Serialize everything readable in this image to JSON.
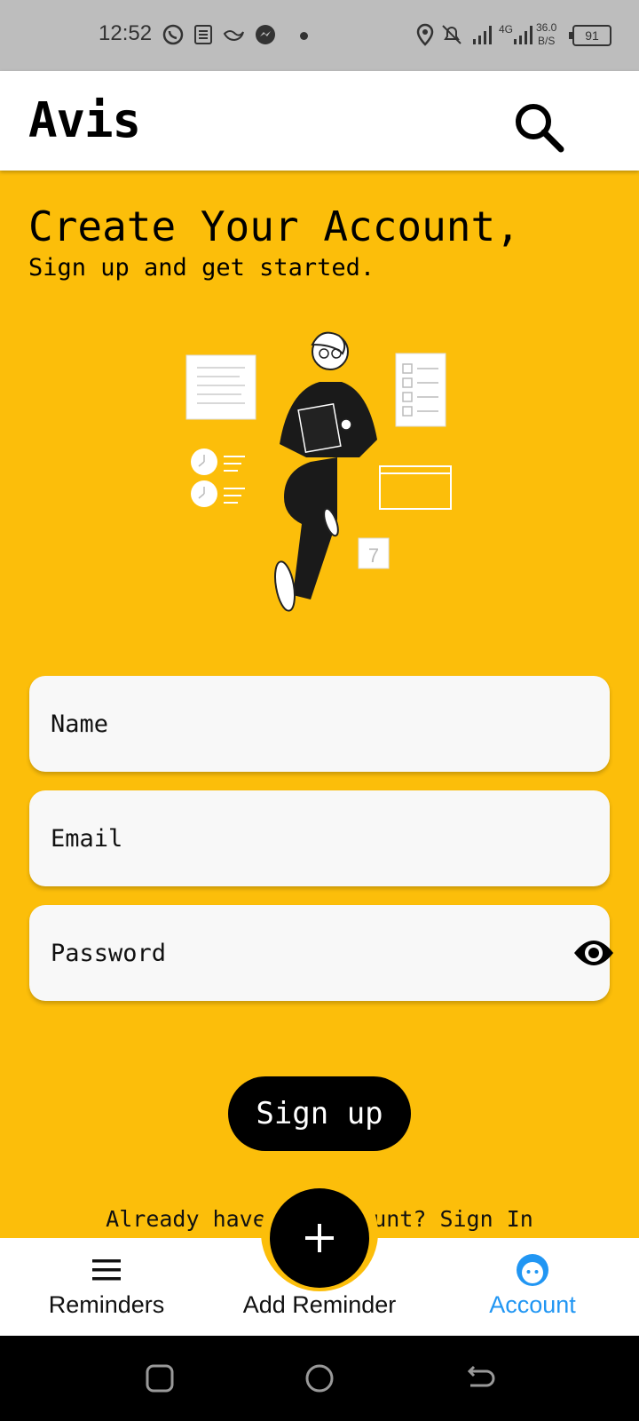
{
  "status_bar": {
    "time": "12:52",
    "network_speed_value": "36.0",
    "network_speed_unit": "B/S",
    "network_type": "4G",
    "battery": "91"
  },
  "app": {
    "title": "Avis"
  },
  "hero": {
    "headline": "Create Your Account,",
    "subline": "Sign up and get started."
  },
  "form": {
    "name_placeholder": "Name",
    "email_placeholder": "Email",
    "password_placeholder": "Password",
    "signup_label": "Sign up"
  },
  "signin": {
    "text": "Already have an account? Sign In"
  },
  "bottom_nav": {
    "items": [
      {
        "label": "Reminders",
        "icon": "menu-icon"
      },
      {
        "label": "Add Reminder",
        "icon": "plus-icon"
      },
      {
        "label": "Account",
        "icon": "account-face-icon",
        "active": true
      }
    ]
  },
  "colors": {
    "background": "#fcbe0a",
    "accent_active": "#2196f3",
    "field_bg": "#f8f8f8",
    "button_bg": "#000000"
  }
}
